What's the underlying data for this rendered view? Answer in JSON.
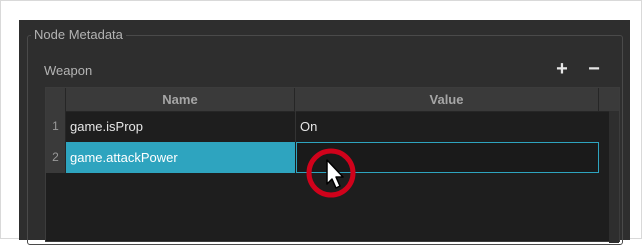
{
  "group": {
    "title": "Node Metadata"
  },
  "section": {
    "title": "Weapon"
  },
  "buttons": {
    "add_label": "+",
    "remove_label": "−"
  },
  "table": {
    "columns": [
      "Name",
      "Value"
    ],
    "rows": [
      {
        "index": "1",
        "name": "game.isProp",
        "value": "On"
      },
      {
        "index": "2",
        "name": "game.attackPower",
        "value": ""
      }
    ]
  },
  "colors": {
    "selection": "#2ea4bf",
    "highlight_circle": "#d0021b",
    "panel_bg": "#2e2e2e"
  }
}
